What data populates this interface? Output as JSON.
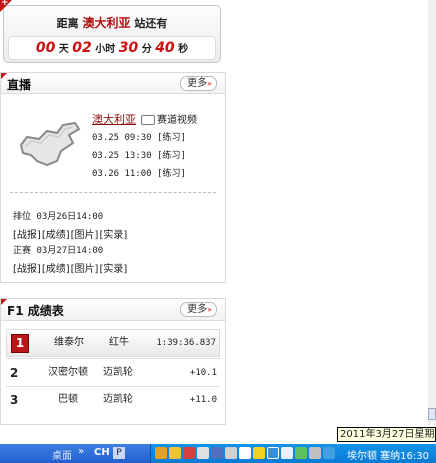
{
  "countdown": {
    "prefix": "距离",
    "place": "澳大利亚",
    "suffix": "站还有",
    "days": "00",
    "days_unit": "天",
    "hours": "02",
    "hours_unit": "小时",
    "minutes": "30",
    "minutes_unit": "分",
    "seconds": "40",
    "seconds_unit": "秒"
  },
  "live": {
    "title": "直播",
    "more": "更多",
    "country": "澳大利亚",
    "video": "赛道视频",
    "sessions": [
      {
        "time": "03.25 09:30",
        "label": "[练习]"
      },
      {
        "time": "03.25 13:30",
        "label": "[练习]"
      },
      {
        "time": "03.26 11:00",
        "label": "[练习]"
      }
    ],
    "qualifying": {
      "name": "排位",
      "time": "03月26日14:00"
    },
    "race": {
      "name": "正赛",
      "time": "03月27日14:00"
    },
    "links": [
      "[战报]",
      "[成绩]",
      "[图片]",
      "[实录]"
    ]
  },
  "results": {
    "title": "F1 成绩表",
    "more": "更多",
    "rows": [
      {
        "pos": "1",
        "driver": "维泰尔",
        "team": "红牛",
        "time": "1:39:36.837"
      },
      {
        "pos": "2",
        "driver": "汉密尔顿",
        "team": "迈凯轮",
        "time": "+10.1"
      },
      {
        "pos": "3",
        "driver": "巴顿",
        "team": "迈凯轮",
        "time": "+11.0"
      }
    ]
  },
  "date_tooltip": "2011年3月27日星期日",
  "taskbar": {
    "desktop": "桌面",
    "chevron": "»",
    "lang": "CH",
    "ime": "P",
    "status_text": "埃尔顿 塞纳16:30"
  }
}
